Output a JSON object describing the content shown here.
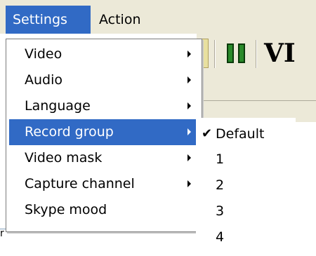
{
  "menubar": {
    "items": [
      {
        "label": "Settings"
      },
      {
        "label": "Action"
      }
    ]
  },
  "toolbar": {
    "brand_text": "VI",
    "pause_icon": "pause-icon"
  },
  "status": {
    "fragment": "r"
  },
  "settings_menu": {
    "items": [
      {
        "label": "Video",
        "has_submenu": true
      },
      {
        "label": "Audio",
        "has_submenu": true
      },
      {
        "label": "Language",
        "has_submenu": true
      },
      {
        "label": "Record group",
        "has_submenu": true,
        "highlighted": true
      },
      {
        "label": "Video mask",
        "has_submenu": true
      },
      {
        "label": "Capture channel",
        "has_submenu": true
      },
      {
        "label": "Skype mood",
        "has_submenu": false
      }
    ]
  },
  "record_group_submenu": {
    "items": [
      {
        "label": "Default",
        "checked": true
      },
      {
        "label": "1",
        "checked": false
      },
      {
        "label": "2",
        "checked": false
      },
      {
        "label": "3",
        "checked": false
      },
      {
        "label": "4",
        "checked": false
      }
    ],
    "check_glyph": "✔"
  },
  "colors": {
    "highlight": "#316ac5",
    "menubar_bg": "#ece9d8",
    "pause_green": "#2a8a2a"
  }
}
